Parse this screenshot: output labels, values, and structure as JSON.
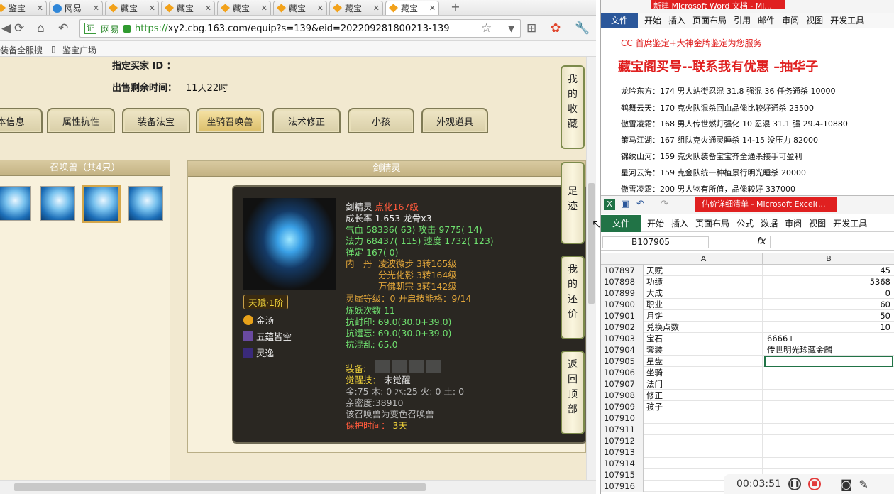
{
  "browser": {
    "tabs": [
      {
        "label": "鉴宝",
        "icon": "diamond"
      },
      {
        "label": "网易",
        "icon": "round"
      },
      {
        "label": "藏宝",
        "icon": "diamond"
      },
      {
        "label": "藏宝",
        "icon": "diamond"
      },
      {
        "label": "藏宝",
        "icon": "diamond"
      },
      {
        "label": "藏宝",
        "icon": "diamond"
      },
      {
        "label": "藏宝",
        "icon": "diamond"
      },
      {
        "label": "藏宝",
        "icon": "diamond"
      }
    ],
    "new_tab": "+",
    "url_cert": "证",
    "url_site": "网易",
    "url_scheme": "https://",
    "url_rest": "xy2.cbg.163.com/equip?s=139&eid=202209281800213-139",
    "bookmarks": [
      "装备全服搜",
      "鉴宝广场"
    ]
  },
  "page": {
    "buyer_label": "指定买家 ID ：",
    "remaining_label": "出售剩余时间：",
    "remaining_value": "11天22时",
    "tabs": [
      "本信息",
      "属性抗性",
      "装备法宝",
      "坐骑召唤兽",
      "法术修正",
      "小孩",
      "外观道具"
    ],
    "active_tab_index": 3,
    "left_panel_title": "召唤兽（共4只）",
    "right_panel_title": "剑精灵",
    "pet": {
      "name": "剑精灵",
      "tag": "点化167级",
      "growth": "成长率 1.653 龙骨x3",
      "hp": "气血 58336( 63)",
      "attack": "攻击 9775( 14)",
      "mana": "法力 68437( 115)",
      "speed": "速度 1732( 123)",
      "zen": "禅定 167( 0)",
      "dan_label": "内　丹",
      "dan1": "凌波微步 3转165级",
      "dan2": "分光化影 3转164级",
      "dan3": "万佛朝宗 3转142级",
      "talent": "天赋·1阶",
      "skills": [
        "金汤",
        "五蕴皆空",
        "灵逸"
      ],
      "spirit": "灵犀等级：0 开启技能格：9/14",
      "refine": "炼妖次数 11",
      "res1": "抗封印: 69.0(30.0+39.0)",
      "res2": "抗遗忘: 69.0(30.0+39.0)",
      "res3": "抗混乱: 65.0",
      "equip_label": "装备:",
      "awake_label": "觉醒技：",
      "awake_value": "未觉醒",
      "elements": "金:75 木: 0 水:25 火: 0 土: 0",
      "intimacy": "亲密度:38910",
      "variant": "该召唤兽为变色召唤兽",
      "protect_label": "保护时间：",
      "protect_value": "3天"
    },
    "side_buttons": [
      "我的收藏",
      "足迹",
      "我的还价",
      "返回顶部"
    ]
  },
  "word": {
    "title": "新建 Microsoft Word 文档 - Mi...",
    "file": "文件",
    "menu": [
      "开始",
      "插入",
      "页面布局",
      "引用",
      "邮件",
      "审阅",
      "视图",
      "开发工具"
    ],
    "headline": "CC 首席鉴定+大神金牌鉴定为您服务",
    "big": "藏宝阁买号--联系我有优惠 –抽华子",
    "lines": [
      "龙吟东方：174 男人站街忍混 31.8 强混 36 任务通杀 10000",
      "鹤舞云天：170 克火队混杀回血品像比较好通杀 23500",
      "傲雪凌霜：168 男人传世燃灯强化 10 忍混 31.1 强 29.4-10880",
      "策马江湖：167 组队克火通灵睡杀 14-15 没压力 82000",
      "锦绣山河：159 克火队装备宝宝齐全通杀接手可盈利",
      "星河云海：159 克金队统一种植景行明光睡杀 20000",
      "傲雪凌霜：200 男人物有所值，品像较好 337000"
    ]
  },
  "excel": {
    "title": "估价详细清单 - Microsoft Excel(...",
    "file": "文件",
    "menu": [
      "开始",
      "插入",
      "页面布局",
      "公式",
      "数据",
      "审阅",
      "视图",
      "开发工具"
    ],
    "namebox": "B107905",
    "fx": "fx",
    "col_a": "A",
    "col_b": "B",
    "rows": [
      {
        "n": "107897",
        "a": "天赋",
        "b": "45",
        "num": true
      },
      {
        "n": "107898",
        "a": "功绩",
        "b": "5368",
        "num": true
      },
      {
        "n": "107899",
        "a": "大成",
        "b": "0",
        "num": true
      },
      {
        "n": "107900",
        "a": "职业",
        "b": "60",
        "num": true
      },
      {
        "n": "107901",
        "a": "月饼",
        "b": "50",
        "num": true
      },
      {
        "n": "107902",
        "a": "兑换点数",
        "b": "10",
        "num": true
      },
      {
        "n": "107903",
        "a": "宝石",
        "b": "6666+",
        "num": false
      },
      {
        "n": "107904",
        "a": "套装",
        "b": "传世明光珍藏金麟",
        "num": false
      },
      {
        "n": "107905",
        "a": "星盘",
        "b": "",
        "num": false
      },
      {
        "n": "107906",
        "a": "坐骑",
        "b": "",
        "num": false
      },
      {
        "n": "107907",
        "a": "法门",
        "b": "",
        "num": false
      },
      {
        "n": "107908",
        "a": "修正",
        "b": "",
        "num": false
      },
      {
        "n": "107909",
        "a": "孩子",
        "b": "",
        "num": false
      },
      {
        "n": "107910",
        "a": "",
        "b": "",
        "num": false
      },
      {
        "n": "107911",
        "a": "",
        "b": "",
        "num": false
      },
      {
        "n": "107912",
        "a": "",
        "b": "",
        "num": false
      },
      {
        "n": "107913",
        "a": "",
        "b": "",
        "num": false
      },
      {
        "n": "107914",
        "a": "",
        "b": "",
        "num": false
      },
      {
        "n": "107915",
        "a": "",
        "b": "",
        "num": false
      },
      {
        "n": "107916",
        "a": "",
        "b": "",
        "num": false
      }
    ]
  },
  "recorder": {
    "time": "00:03:51"
  }
}
